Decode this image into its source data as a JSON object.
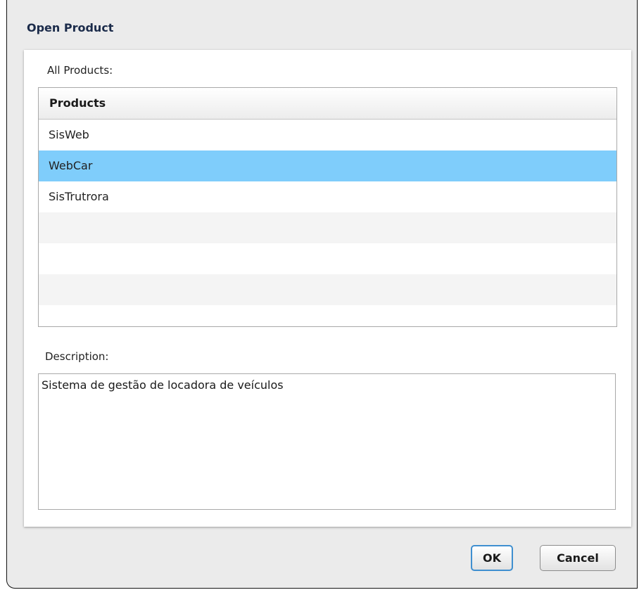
{
  "dialog": {
    "title": "Open Product"
  },
  "products": {
    "label": "All Products:",
    "column_header": "Products",
    "rows": [
      "SisWeb",
      "WebCar",
      "SisTrutrora",
      "",
      "",
      "",
      ""
    ],
    "selected_index": 1
  },
  "description": {
    "label": "Description:",
    "value": "Sistema de gestão de locadora de veículos"
  },
  "buttons": {
    "ok_label": "OK",
    "cancel_label": "Cancel"
  },
  "colors": {
    "selected_row": "#7fcdfb",
    "ok_border": "#3f8fd0"
  }
}
